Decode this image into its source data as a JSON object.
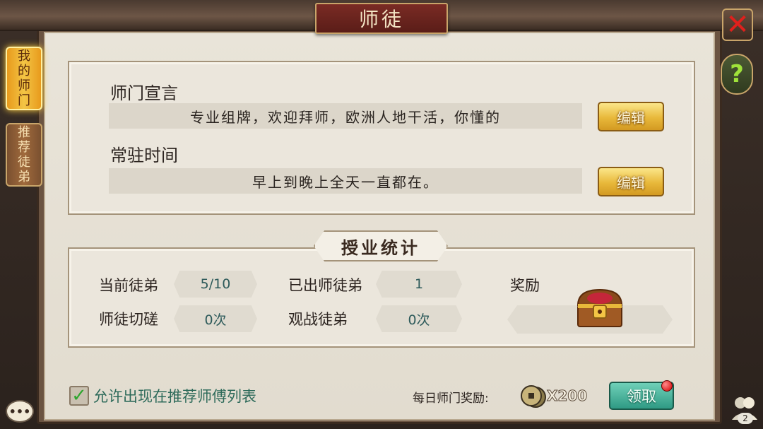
{
  "window": {
    "title": "师徒"
  },
  "tabs": [
    {
      "label": "我的师门",
      "active": true
    },
    {
      "label": "推荐徒弟",
      "active": false
    }
  ],
  "declaration": {
    "heading": "师门宣言",
    "text": "专业组牌，欢迎拜师，欧洲人地干活，你懂的",
    "edit_label": "编辑"
  },
  "resident_time": {
    "heading": "常驻时间",
    "text": "早上到晚上全天一直都在。",
    "edit_label": "编辑"
  },
  "stats": {
    "title": "授业统计",
    "current_disciples_label": "当前徒弟",
    "current_disciples_value": "5/10",
    "graduated_label": "已出师徒弟",
    "graduated_value": "1",
    "reward_label": "奖励",
    "sparring_label": "师徒切磋",
    "sparring_value": "0次",
    "spectate_label": "观战徒弟",
    "spectate_value": "0次"
  },
  "footer": {
    "allow_checkbox_checked": true,
    "allow_label": "允许出现在推荐师傅列表",
    "daily_reward_label": "每日师门奖励:",
    "coin_count": "X200",
    "claim_label": "领取",
    "friends_badge": "2"
  },
  "icons": {
    "close": "close-icon",
    "help": "help-icon",
    "chest": "treasure-chest-icon",
    "coin": "copper-coin-icon",
    "chat": "chat-icon",
    "friends": "friends-icon"
  },
  "colors": {
    "gold_button": "#e8b83a",
    "claim_button": "#2f9a84",
    "tab_active": "#f3c545",
    "title_plate": "#7a2b24",
    "close_x": "#e0201c",
    "help_mark": "#9fe23a"
  }
}
